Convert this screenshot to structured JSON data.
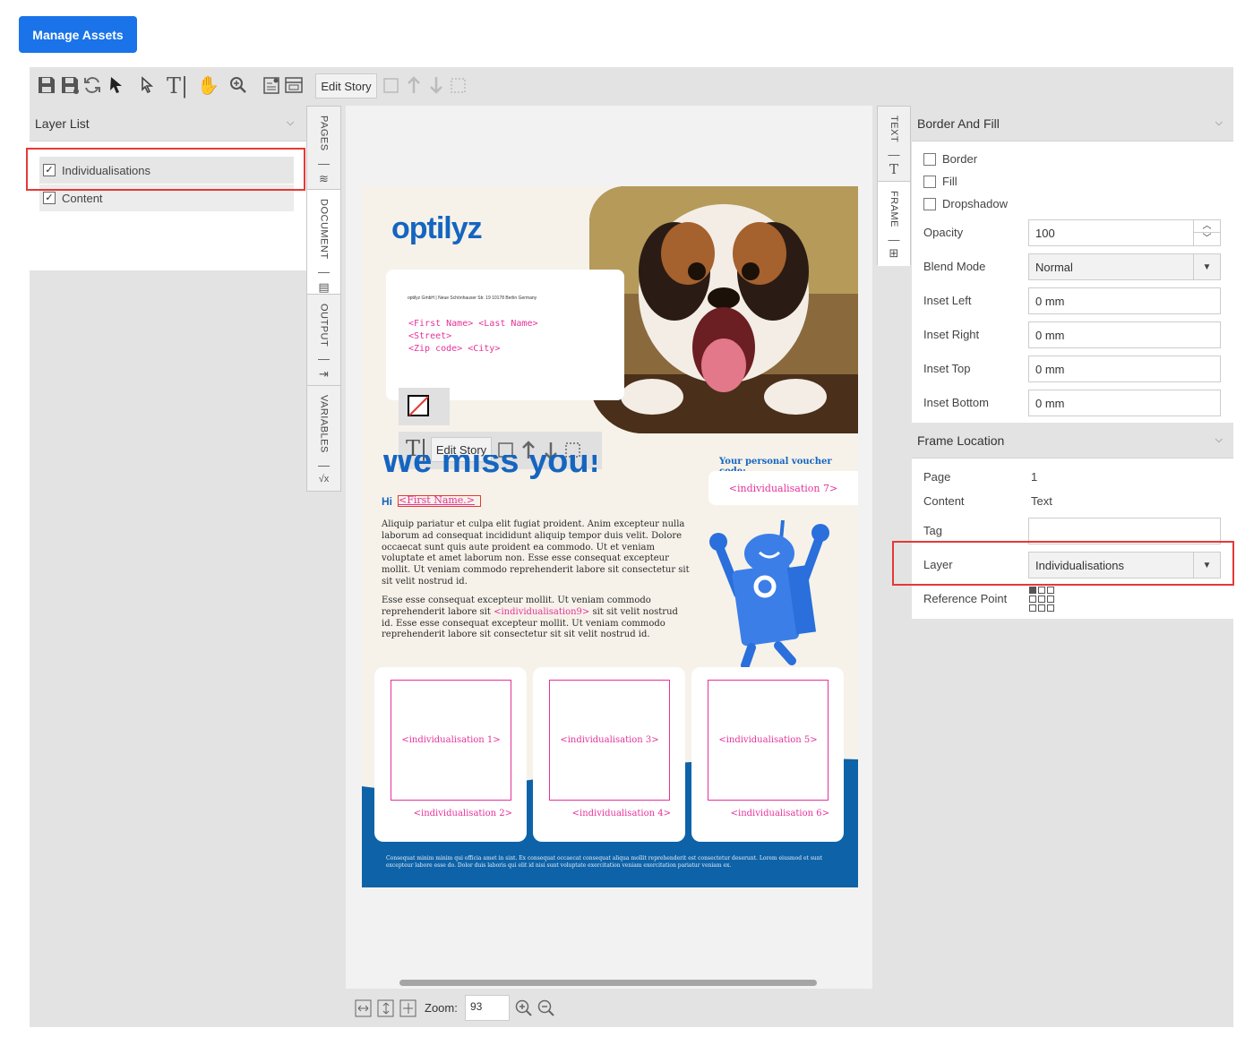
{
  "header": {
    "manage_assets_label": "Manage Assets"
  },
  "toolbar": {
    "edit_story_label": "Edit Story",
    "icons": [
      "save-icon",
      "save-as-icon",
      "refresh-icon",
      "select-icon",
      "direct-select-icon",
      "text-tool-icon",
      "hand-tool-icon",
      "zoom-tool-icon",
      "page-settings-icon",
      "frame-settings-icon",
      "frame-icon",
      "arrow-up-icon",
      "arrow-down-icon",
      "frame-dashed-icon"
    ]
  },
  "layer_list": {
    "title": "Layer List",
    "items": [
      {
        "label": "Individualisations",
        "checked": true
      },
      {
        "label": "Content",
        "checked": true
      }
    ]
  },
  "left_tabs": [
    "PAGES",
    "DOCUMENT",
    "OUTPUT",
    "VARIABLES"
  ],
  "right_tabs": [
    "TEXT",
    "FRAME"
  ],
  "document": {
    "logo": "optilyz",
    "sender_line": "optilyz GmbH | Neue Schönhauser Str. 19 10178 Berlin Germany",
    "address_lines": [
      "<First Name> <Last Name>",
      "<Street>",
      "<Zip code> <City>"
    ],
    "floating_edit_story": "Edit Story",
    "headline": "We miss you!",
    "greeting_prefix": "Hi",
    "greeting_field": "<First Name.>",
    "voucher_title": "Your personal voucher code:",
    "voucher_field": "<individualisation 7>",
    "paragraph1": "Aliquip pariatur et culpa elit fugiat proident. Anim excepteur nulla laborum ad consequat incididunt aliquip tempor duis velit. Dolore occaecat sunt quis aute proident ea commodo. Ut et veniam voluptate et amet laborum non. Esse esse consequat excepteur mollit. Ut veniam commodo reprehenderit labore sit consectetur sit sit velit nostrud id.",
    "paragraph2_a": "Esse esse consequat excepteur mollit. Ut veniam commodo reprehenderit labore sit",
    "paragraph2_field": "<individualisation9>",
    "paragraph2_b": "sit sit velit nostrud id. Esse esse consequat excepteur mollit. Ut veniam commodo reprehenderit labore sit consectetur sit sit velit nostrud id.",
    "boxes": [
      {
        "main": "<individualisation 1>",
        "sub": "<individualisation 2>"
      },
      {
        "main": "<individualisation 3>",
        "sub": "<individualisation 4>"
      },
      {
        "main": "<individualisation 5>",
        "sub": "<individualisation 6>"
      }
    ],
    "footer_text": "Consequat minim minim qui officia amet in sint. Ex consequat occaecat consequat aliqua mollit reprehenderit est consectetur deserunt. Lorem eiusmod et sunt excepteur labore esse do. Dolor duis laboris qui elit id nisi sunt voluptate exercitation veniam exercitation pariatur veniam ex."
  },
  "bottom_bar": {
    "zoom_label": "Zoom:",
    "zoom_value": "93"
  },
  "border_and_fill": {
    "title": "Border And Fill",
    "checkboxes": [
      "Border",
      "Fill",
      "Dropshadow"
    ],
    "opacity_label": "Opacity",
    "opacity_value": "100",
    "blend_mode_label": "Blend Mode",
    "blend_mode_value": "Normal",
    "inset_left_label": "Inset Left",
    "inset_left_value": "0 mm",
    "inset_right_label": "Inset Right",
    "inset_right_value": "0 mm",
    "inset_top_label": "Inset Top",
    "inset_top_value": "0 mm",
    "inset_bottom_label": "Inset Bottom",
    "inset_bottom_value": "0 mm"
  },
  "frame_location": {
    "title": "Frame Location",
    "page_label": "Page",
    "page_value": "1",
    "content_label": "Content",
    "content_value": "Text",
    "tag_label": "Tag",
    "tag_value": "",
    "layer_label": "Layer",
    "layer_value": "Individualisations",
    "reference_point_label": "Reference Point"
  },
  "colors": {
    "accent": "#1a73e8",
    "brand": "#1565c0",
    "highlight": "#e53935",
    "field": "#e6329a"
  }
}
